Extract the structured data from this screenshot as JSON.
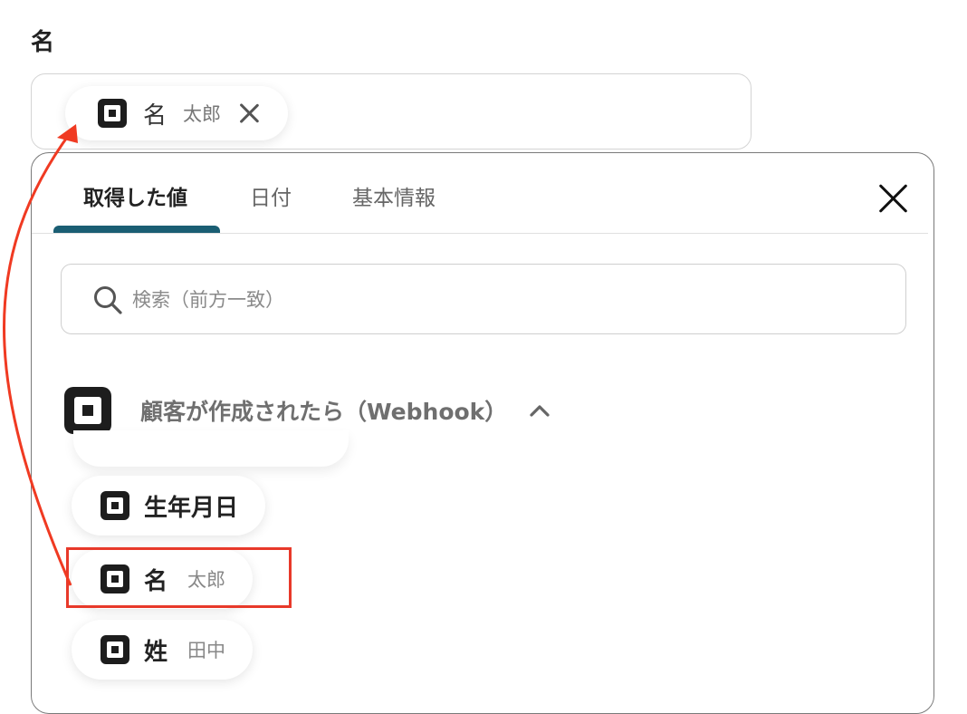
{
  "field": {
    "label": "名",
    "selected_token": {
      "name": "名",
      "value": "太郎"
    }
  },
  "panel": {
    "tabs": [
      {
        "label": "取得した値",
        "active": true
      },
      {
        "label": "日付",
        "active": false
      },
      {
        "label": "基本情報",
        "active": false
      }
    ],
    "search": {
      "placeholder": "検索（前方一致）",
      "value": ""
    },
    "section": {
      "title": "顧客が作成されたら（Webhook）",
      "expanded": true
    },
    "items": [
      {
        "name": "生年月日",
        "value": ""
      },
      {
        "name": "名",
        "value": "太郎",
        "highlighted": true
      },
      {
        "name": "姓",
        "value": "田中"
      }
    ]
  },
  "colors": {
    "accent_tab": "#1a5e73",
    "highlight": "#e8392a",
    "icon": "#1d1d1d"
  },
  "icons": {
    "token": "square-app-icon",
    "close": "close-icon",
    "search": "search-icon",
    "chevron": "chevron-up-icon"
  }
}
